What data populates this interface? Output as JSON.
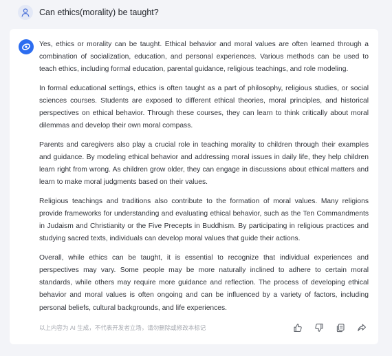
{
  "conversation": {
    "question": "Can ethics(morality) be taught?",
    "answer_paragraphs": [
      "Yes, ethics or morality can be taught. Ethical behavior and moral values are often learned through a combination of socialization, education, and personal experiences. Various methods can be used to teach ethics, including formal education, parental guidance, religious teachings, and role modeling.",
      "In formal educational settings, ethics is often taught as a part of philosophy, religious studies, or social sciences courses. Students are exposed to different ethical theories, moral principles, and historical perspectives on ethical behavior. Through these courses, they can learn to think critically about moral dilemmas and develop their own moral compass.",
      "Parents and caregivers also play a crucial role in teaching morality to children through their examples and guidance. By modeling ethical behavior and addressing moral issues in daily life, they help children learn right from wrong. As children grow older, they can engage in discussions about ethical matters and learn to make moral judgments based on their values.",
      "Religious teachings and traditions also contribute to the formation of moral values. Many religions provide frameworks for understanding and evaluating ethical behavior, such as the Ten Commandments in Judaism and Christianity or the Five Precepts in Buddhism. By participating in religious practices and studying sacred texts, individuals can develop moral values that guide their actions.",
      "Overall, while ethics can be taught, it is essential to recognize that individual experiences and perspectives may vary. Some people may be more naturally inclined to adhere to certain moral standards, while others may require more guidance and reflection. The process of developing ethical behavior and moral values is often ongoing and can be influenced by a variety of factors, including personal beliefs, cultural backgrounds, and life experiences."
    ],
    "disclaimer": "以上内容为 AI 生成，不代表开发者立场，请勿删除或修改本标记"
  },
  "icons": {
    "user": "user-icon",
    "bot": "bot-logo-icon",
    "like": "thumbs-up-icon",
    "dislike": "thumbs-down-icon",
    "copy": "copy-icon",
    "share": "share-icon"
  },
  "colors": {
    "background": "#f3f4f8",
    "card": "#ffffff",
    "accent": "#2c6df0",
    "text": "#30333a",
    "muted": "#a6a9b0"
  }
}
